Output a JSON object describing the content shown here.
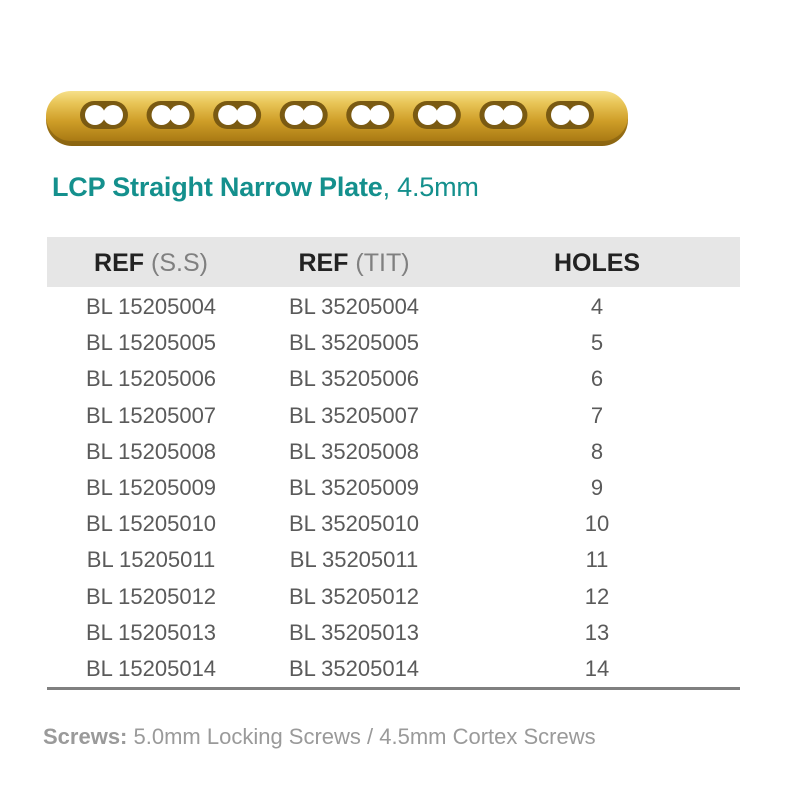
{
  "colors": {
    "title": "#14908d",
    "header_bg": "#e6e6e6",
    "plate_gold": "#d4a32a",
    "cell_text": "#5a5a5a",
    "footnote_text": "#9a9a9a"
  },
  "product": {
    "image_icon": "bone-plate-image",
    "hole_count": 8,
    "title_bold": "LCP Straight Narrow Plate",
    "title_rest": ", 4.5mm"
  },
  "table": {
    "headers": [
      {
        "strong": "REF",
        "light": " (S.S)"
      },
      {
        "strong": "REF",
        "light": " (TIT)"
      },
      {
        "strong": "HOLES",
        "light": ""
      }
    ],
    "rows": [
      {
        "ss": "BL 15205004",
        "tit": "BL 35205004",
        "holes": "4"
      },
      {
        "ss": "BL 15205005",
        "tit": "BL 35205005",
        "holes": "5"
      },
      {
        "ss": "BL 15205006",
        "tit": "BL 35205006",
        "holes": "6"
      },
      {
        "ss": "BL 15205007",
        "tit": "BL 35205007",
        "holes": "7"
      },
      {
        "ss": "BL 15205008",
        "tit": "BL 35205008",
        "holes": "8"
      },
      {
        "ss": "BL 15205009",
        "tit": "BL 35205009",
        "holes": "9"
      },
      {
        "ss": "BL 15205010",
        "tit": "BL 35205010",
        "holes": "10"
      },
      {
        "ss": "BL 15205011",
        "tit": "BL 35205011",
        "holes": "11"
      },
      {
        "ss": "BL 15205012",
        "tit": "BL 35205012",
        "holes": "12"
      },
      {
        "ss": "BL 15205013",
        "tit": "BL 35205013",
        "holes": "13"
      },
      {
        "ss": "BL 15205014",
        "tit": "BL 35205014",
        "holes": "14"
      }
    ]
  },
  "footnote": {
    "label": "Screws:",
    "text": " 5.0mm Locking Screws / 4.5mm Cortex Screws"
  }
}
